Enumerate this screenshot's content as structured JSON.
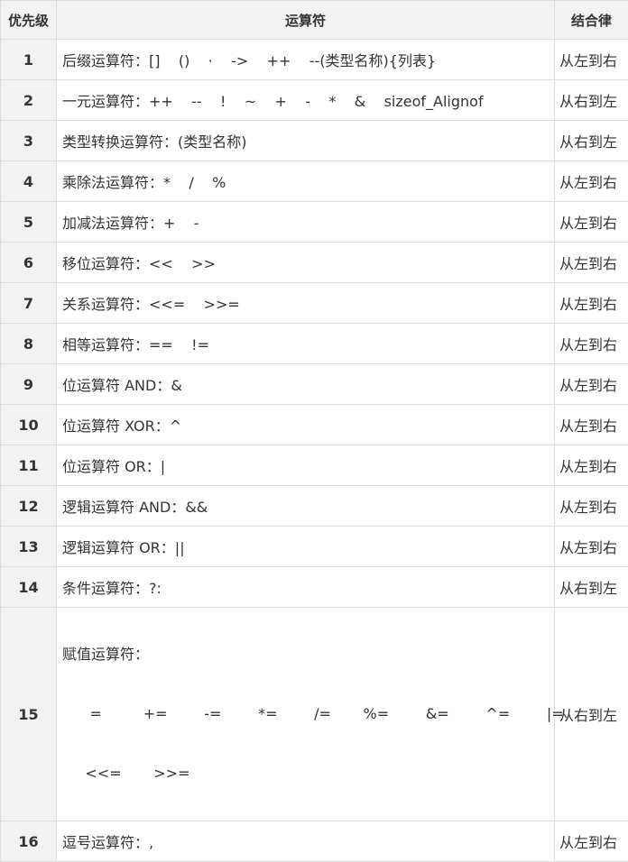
{
  "header": {
    "priority": "优先级",
    "operator": "运算符",
    "associativity": "结合律"
  },
  "rows": [
    {
      "priority": "1",
      "operator": "后缀运算符：[]    ()    ·    ->    ++    --(类型名称){列表}",
      "associativity": "从左到右"
    },
    {
      "priority": "2",
      "operator": "一元运算符：++    --    !    ~    +    -    *    &    sizeof_Alignof",
      "associativity": "从右到左"
    },
    {
      "priority": "3",
      "operator": "类型转换运算符：(类型名称)",
      "associativity": "从右到左"
    },
    {
      "priority": "4",
      "operator": "乘除法运算符：*    /    %",
      "associativity": "从左到右"
    },
    {
      "priority": "5",
      "operator": "加减法运算符：+    -",
      "associativity": "从左到右"
    },
    {
      "priority": "6",
      "operator": "移位运算符：<<    >>",
      "associativity": "从左到右"
    },
    {
      "priority": "7",
      "operator": "关系运算符：<<=    >>=",
      "associativity": "从左到右"
    },
    {
      "priority": "8",
      "operator": "相等运算符：==    !=",
      "associativity": "从左到右"
    },
    {
      "priority": "9",
      "operator": "位运算符 AND：&",
      "associativity": "从左到右"
    },
    {
      "priority": "10",
      "operator": "位运算符 XOR：^",
      "associativity": "从左到右"
    },
    {
      "priority": "11",
      "operator": "位运算符 OR：|",
      "associativity": "从左到右"
    },
    {
      "priority": "12",
      "operator": "逻辑运算符 AND：&&",
      "associativity": "从左到右"
    },
    {
      "priority": "13",
      "operator": "逻辑运算符 OR：||",
      "associativity": "从左到右"
    },
    {
      "priority": "14",
      "operator": "条件运算符：?:",
      "associativity": "从右到左"
    },
    {
      "priority": "15",
      "operator_lines": [
        "赋值运算符：",
        "      =         +=        -=        *=        /=       %=        &=        ^=        |=",
        "     <<=       >>="
      ],
      "associativity": "从右到左"
    },
    {
      "priority": "16",
      "operator": "逗号运算符：,",
      "associativity": "从左到右"
    }
  ]
}
